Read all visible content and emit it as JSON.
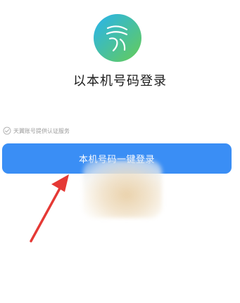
{
  "login": {
    "title": "以本机号码登录",
    "service_note": "天翼账号提供认证服务",
    "button_label": "本机号码一键登录"
  },
  "icons": {
    "logo": "app-logo-icon",
    "check": "shield-check-icon",
    "arrow": "red-arrow-annotation-icon"
  },
  "colors": {
    "button": "#3a8ef5",
    "logo_gradient_start": "#2fb0ea",
    "logo_gradient_end": "#5cc96a",
    "annotation_arrow": "#e53935"
  }
}
